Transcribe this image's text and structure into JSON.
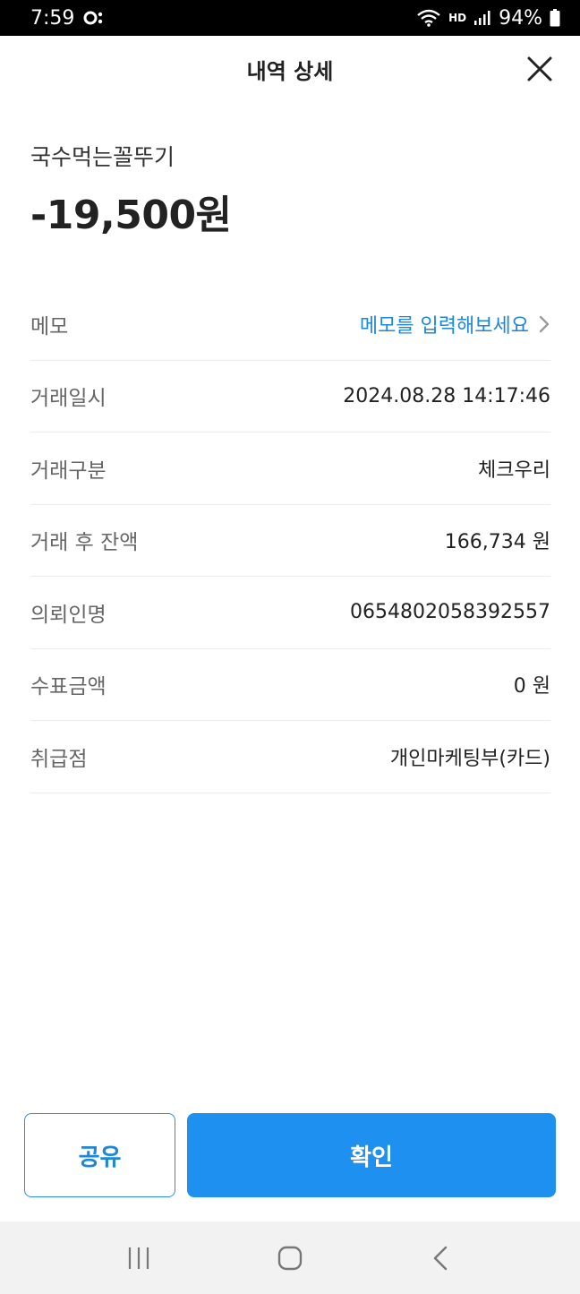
{
  "status": {
    "time": "7:59",
    "battery": "94%",
    "network_label": "HD"
  },
  "header": {
    "title": "내역 상세"
  },
  "transaction": {
    "merchant": "국수먹는꼴뚜기",
    "amount": "-19,500원"
  },
  "memo": {
    "label": "메모",
    "placeholder": "메모를 입력해보세요"
  },
  "details": [
    {
      "label": "거래일시",
      "value": "2024.08.28 14:17:46"
    },
    {
      "label": "거래구분",
      "value": "체크우리"
    },
    {
      "label": "거래 후 잔액",
      "value": "166,734 원"
    },
    {
      "label": "의뢰인명",
      "value": "0654802058392557"
    },
    {
      "label": "수표금액",
      "value": "0 원"
    },
    {
      "label": "취급점",
      "value": "개인마케팅부(카드)"
    }
  ],
  "buttons": {
    "share": "공유",
    "confirm": "확인"
  },
  "colors": {
    "accent": "#1e90ef",
    "link": "#1e87d8"
  }
}
